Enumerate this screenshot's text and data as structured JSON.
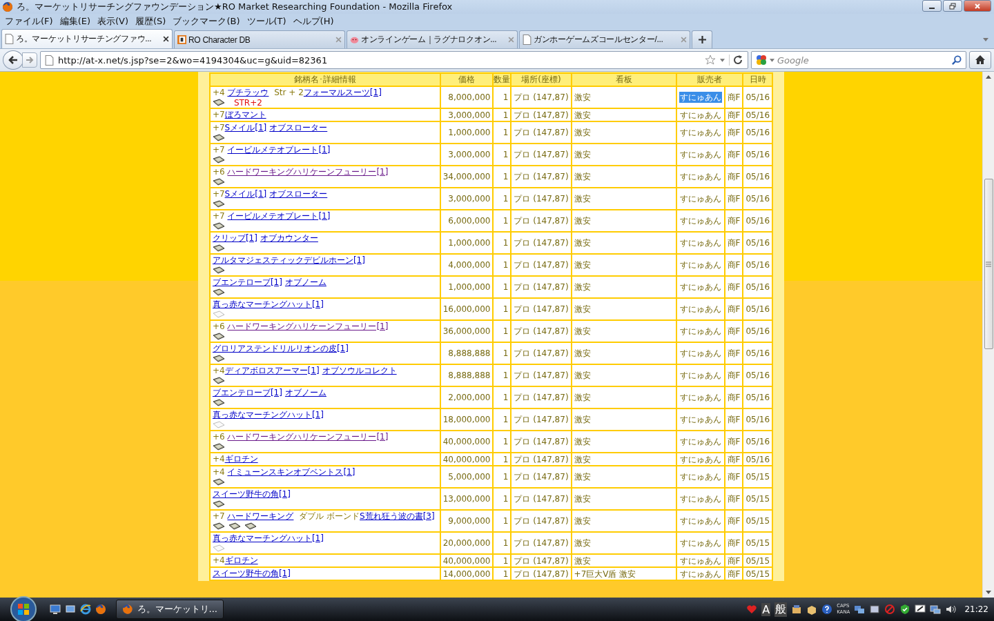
{
  "window": {
    "title": "ろ。マーケットリサーチングファウンデーション★RO Market Researching Foundation - Mozilla Firefox"
  },
  "menu": [
    "ファイル(F)",
    "編集(E)",
    "表示(V)",
    "履歴(S)",
    "ブックマーク(B)",
    "ツール(T)",
    "ヘルプ(H)"
  ],
  "tabs": [
    {
      "label": "ろ。マーケットリサーチングファウ...",
      "selected": true
    },
    {
      "label": "RO Character DB",
      "selected": false
    },
    {
      "label": "オンラインゲーム｜ラグナロクオン...",
      "selected": false
    },
    {
      "label": "ガンホーゲームズコールセンター/...",
      "selected": false
    }
  ],
  "address": {
    "value": "http://at-x.net/s.jsp?se=2&wo=4194304&uc=g&uid=82361"
  },
  "search": {
    "placeholder": "Google"
  },
  "table": {
    "columns": [
      "銘柄名･詳細情報",
      "価格",
      "数量",
      "場所(座標)",
      "看板",
      "販売者",
      "日時"
    ],
    "rows": [
      {
        "item": [
          {
            "kind": "text",
            "text": "+4 "
          },
          {
            "kind": "link",
            "text": "ブチラッウ"
          },
          {
            "kind": "text",
            "text": " Str + 2"
          },
          {
            "kind": "link",
            "text": "フォーマルスーツ[1]"
          }
        ],
        "note": "STR+2",
        "cards": [
          {
            "filled": true
          }
        ],
        "price": "8,000,000",
        "qty": "1",
        "place": "プロ (147,87)",
        "sign": "激安",
        "seller": "すにゅあん",
        "seller_highlighted": true,
        "shop": "商F",
        "date": "05/16"
      },
      {
        "item": [
          {
            "kind": "text",
            "text": "+7"
          },
          {
            "kind": "link",
            "text": "ぼろマント"
          }
        ],
        "cards": [],
        "price": "3,000,000",
        "qty": "1",
        "place": "プロ (147,87)",
        "sign": "激安",
        "seller": "すにゅあん",
        "seller_highlighted": false,
        "shop": "商F",
        "date": "05/16"
      },
      {
        "item": [
          {
            "kind": "text",
            "text": "+7"
          },
          {
            "kind": "link",
            "text": "Sメイル[1]"
          },
          {
            "kind": "link",
            "text": "オブスローター"
          }
        ],
        "cards": [
          {
            "filled": true
          }
        ],
        "price": "1,000,000",
        "qty": "1",
        "place": "プロ (147,87)",
        "sign": "激安",
        "seller": "すにゅあん",
        "seller_highlighted": false,
        "shop": "商F",
        "date": "05/16"
      },
      {
        "item": [
          {
            "kind": "text",
            "text": "+7 "
          },
          {
            "kind": "link",
            "text": "イービルメテオプレート[1]"
          }
        ],
        "cards": [
          {
            "filled": true
          }
        ],
        "price": "3,000,000",
        "qty": "1",
        "place": "プロ (147,87)",
        "sign": "激安",
        "seller": "すにゅあん",
        "seller_highlighted": false,
        "shop": "商F",
        "date": "05/16"
      },
      {
        "item": [
          {
            "kind": "text",
            "text": "+6 "
          },
          {
            "kind": "visited-link",
            "text": "ハードワーキングハリケーンフューリー[1]"
          }
        ],
        "cards": [
          {
            "filled": true
          }
        ],
        "price": "34,000,000",
        "qty": "1",
        "place": "プロ (147,87)",
        "sign": "激安",
        "seller": "すにゅあん",
        "seller_highlighted": false,
        "shop": "商F",
        "date": "05/16"
      },
      {
        "item": [
          {
            "kind": "text",
            "text": "+7"
          },
          {
            "kind": "link",
            "text": "Sメイル[1]"
          },
          {
            "kind": "link",
            "text": "オブスローター"
          }
        ],
        "cards": [
          {
            "filled": true
          }
        ],
        "price": "3,000,000",
        "qty": "1",
        "place": "プロ (147,87)",
        "sign": "激安",
        "seller": "すにゅあん",
        "seller_highlighted": false,
        "shop": "商F",
        "date": "05/16"
      },
      {
        "item": [
          {
            "kind": "text",
            "text": "+7 "
          },
          {
            "kind": "link",
            "text": "イービルメテオプレート[1]"
          }
        ],
        "cards": [
          {
            "filled": true
          }
        ],
        "price": "6,000,000",
        "qty": "1",
        "place": "プロ (147,87)",
        "sign": "激安",
        "seller": "すにゅあん",
        "seller_highlighted": false,
        "shop": "商F",
        "date": "05/16"
      },
      {
        "item": [
          {
            "kind": "link",
            "text": "クリップ[1]"
          },
          {
            "kind": "link",
            "text": "オブカウンター"
          }
        ],
        "cards": [
          {
            "filled": true
          }
        ],
        "price": "1,000,000",
        "qty": "1",
        "place": "プロ (147,87)",
        "sign": "激安",
        "seller": "すにゅあん",
        "seller_highlighted": false,
        "shop": "商F",
        "date": "05/16"
      },
      {
        "item": [
          {
            "kind": "link",
            "text": "アルタマジェスティックデビルホーン[1]"
          }
        ],
        "cards": [
          {
            "filled": true
          }
        ],
        "price": "4,000,000",
        "qty": "1",
        "place": "プロ (147,87)",
        "sign": "激安",
        "seller": "すにゅあん",
        "seller_highlighted": false,
        "shop": "商F",
        "date": "05/16"
      },
      {
        "item": [
          {
            "kind": "link",
            "text": "ブエンテローブ[1]"
          },
          {
            "kind": "link",
            "text": "オブノーム"
          }
        ],
        "cards": [
          {
            "filled": true
          }
        ],
        "price": "1,000,000",
        "qty": "1",
        "place": "プロ (147,87)",
        "sign": "激安",
        "seller": "すにゅあん",
        "seller_highlighted": false,
        "shop": "商F",
        "date": "05/16"
      },
      {
        "item": [
          {
            "kind": "link",
            "text": "真っ赤なマーチングハット[1]"
          }
        ],
        "cards": [
          {
            "filled": false
          }
        ],
        "price": "16,000,000",
        "qty": "1",
        "place": "プロ (147,87)",
        "sign": "激安",
        "seller": "すにゅあん",
        "seller_highlighted": false,
        "shop": "商F",
        "date": "05/16"
      },
      {
        "item": [
          {
            "kind": "text",
            "text": "+6 "
          },
          {
            "kind": "visited-link",
            "text": "ハードワーキングハリケーンフューリー[1]"
          }
        ],
        "cards": [
          {
            "filled": true
          }
        ],
        "price": "36,000,000",
        "qty": "1",
        "place": "プロ (147,87)",
        "sign": "激安",
        "seller": "すにゅあん",
        "seller_highlighted": false,
        "shop": "商F",
        "date": "05/16"
      },
      {
        "item": [
          {
            "kind": "link",
            "text": "グロリアステンドリルリオンの皮[1]"
          }
        ],
        "cards": [
          {
            "filled": true
          }
        ],
        "price": "8,888,888",
        "qty": "1",
        "place": "プロ (147,87)",
        "sign": "激安",
        "seller": "すにゅあん",
        "seller_highlighted": false,
        "shop": "商F",
        "date": "05/16"
      },
      {
        "item": [
          {
            "kind": "text",
            "text": "+4"
          },
          {
            "kind": "link",
            "text": "ディアボロスアーマー[1]"
          },
          {
            "kind": "link",
            "text": "オブソウルコレクト"
          }
        ],
        "cards": [
          {
            "filled": true
          }
        ],
        "price": "8,888,888",
        "qty": "1",
        "place": "プロ (147,87)",
        "sign": "激安",
        "seller": "すにゅあん",
        "seller_highlighted": false,
        "shop": "商F",
        "date": "05/16"
      },
      {
        "item": [
          {
            "kind": "link",
            "text": "ブエンテローブ[1]"
          },
          {
            "kind": "link",
            "text": "オブノーム"
          }
        ],
        "cards": [
          {
            "filled": true
          }
        ],
        "price": "2,000,000",
        "qty": "1",
        "place": "プロ (147,87)",
        "sign": "激安",
        "seller": "すにゅあん",
        "seller_highlighted": false,
        "shop": "商F",
        "date": "05/16"
      },
      {
        "item": [
          {
            "kind": "link",
            "text": "真っ赤なマーチングハット[1]"
          }
        ],
        "cards": [
          {
            "filled": false
          }
        ],
        "price": "18,000,000",
        "qty": "1",
        "place": "プロ (147,87)",
        "sign": "激安",
        "seller": "すにゅあん",
        "seller_highlighted": false,
        "shop": "商F",
        "date": "05/16"
      },
      {
        "item": [
          {
            "kind": "text",
            "text": "+6 "
          },
          {
            "kind": "visited-link",
            "text": "ハードワーキングハリケーンフューリー[1]"
          }
        ],
        "cards": [
          {
            "filled": true
          }
        ],
        "price": "40,000,000",
        "qty": "1",
        "place": "プロ (147,87)",
        "sign": "激安",
        "seller": "すにゅあん",
        "seller_highlighted": false,
        "shop": "商F",
        "date": "05/16"
      },
      {
        "item": [
          {
            "kind": "text",
            "text": "+4"
          },
          {
            "kind": "link",
            "text": "ギロチン"
          }
        ],
        "cards": [],
        "price": "40,000,000",
        "qty": "1",
        "place": "プロ (147,87)",
        "sign": "激安",
        "seller": "すにゅあん",
        "seller_highlighted": false,
        "shop": "商F",
        "date": "05/16"
      },
      {
        "item": [
          {
            "kind": "text",
            "text": "+4 "
          },
          {
            "kind": "link",
            "text": "イミューンスキンオブベントス[1]"
          }
        ],
        "cards": [
          {
            "filled": true
          }
        ],
        "price": "5,000,000",
        "qty": "1",
        "place": "プロ (147,87)",
        "sign": "激安",
        "seller": "すにゅあん",
        "seller_highlighted": false,
        "shop": "商F",
        "date": "05/15"
      },
      {
        "item": [
          {
            "kind": "link",
            "text": "スイーツ野牛の角[1]"
          }
        ],
        "cards": [
          {
            "filled": true
          }
        ],
        "price": "13,000,000",
        "qty": "1",
        "place": "プロ (147,87)",
        "sign": "激安",
        "seller": "すにゅあん",
        "seller_highlighted": false,
        "shop": "商F",
        "date": "05/15"
      },
      {
        "item": [
          {
            "kind": "text",
            "text": "+7 "
          },
          {
            "kind": "link",
            "text": "ハードワーキング"
          },
          {
            "kind": "text",
            "text": " ダブル ボーンド"
          },
          {
            "kind": "link",
            "text": "S荒れ狂う波の書[3]"
          }
        ],
        "cards": [
          {
            "filled": true
          },
          {
            "filled": true
          },
          {
            "filled": true
          }
        ],
        "price": "9,000,000",
        "qty": "1",
        "place": "プロ (147,87)",
        "sign": "激安",
        "seller": "すにゅあん",
        "seller_highlighted": false,
        "shop": "商F",
        "date": "05/15"
      },
      {
        "item": [
          {
            "kind": "link",
            "text": "真っ赤なマーチングハット[1]"
          }
        ],
        "cards": [
          {
            "filled": false
          }
        ],
        "price": "20,000,000",
        "qty": "1",
        "place": "プロ (147,87)",
        "sign": "激安",
        "seller": "すにゅあん",
        "seller_highlighted": false,
        "shop": "商F",
        "date": "05/15"
      },
      {
        "item": [
          {
            "kind": "text",
            "text": "+4"
          },
          {
            "kind": "link",
            "text": "ギロチン"
          }
        ],
        "cards": [],
        "price": "40,000,000",
        "qty": "1",
        "place": "プロ (147,87)",
        "sign": "激安",
        "seller": "すにゅあん",
        "seller_highlighted": false,
        "shop": "商F",
        "date": "05/15"
      },
      {
        "item": [
          {
            "kind": "link",
            "text": "スイーツ野牛の角[1]"
          }
        ],
        "cards": [],
        "price": "14,000,000",
        "qty": "1",
        "place": "プロ (147,87)",
        "sign": "+7巨大V盾 激安",
        "seller": "すにゅあん",
        "seller_highlighted": false,
        "shop": "商F",
        "date": "05/15"
      }
    ]
  },
  "taskbar": {
    "task": "ろ。マーケットリ...",
    "ime": "A",
    "ime_mode": "般",
    "caps": "CAPS",
    "kana": "KANA",
    "clock": "21:22"
  }
}
